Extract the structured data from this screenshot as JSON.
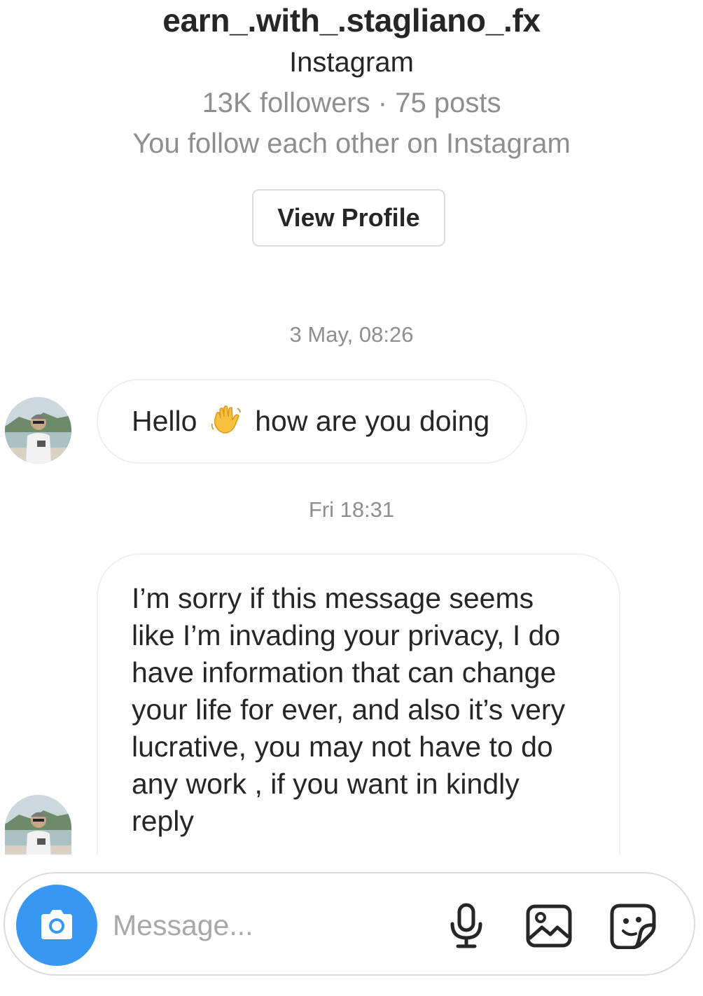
{
  "profile": {
    "username": "earn_.with_.stagliano_.fx",
    "platform": "Instagram",
    "stats": "13K followers · 75 posts",
    "mutual": "You follow each other on Instagram",
    "view_profile_label": "View Profile"
  },
  "conversation": {
    "messages": [
      {
        "timestamp": "3 May, 08:26",
        "text_before_emoji": "Hello",
        "emoji": "👋",
        "text_after_emoji": "how are you doing"
      },
      {
        "timestamp": "Fri 18:31",
        "lines": [
          "I’m sorry if this message seems",
          "like I’m invading your privacy, I do",
          "have information that can change",
          "your life for ever, and also it’s very",
          "lucrative, you may not have to do",
          "any work , if you want in kindly",
          "reply"
        ]
      }
    ]
  },
  "composer": {
    "placeholder": "Message...",
    "icons": {
      "camera": "camera-icon",
      "mic": "microphone-icon",
      "gallery": "image-icon",
      "sticker": "sticker-icon"
    }
  },
  "colors": {
    "accent": "#3897f0",
    "text": "#262626",
    "secondary_text": "#8e8e8e",
    "border": "#dbdbdb"
  }
}
